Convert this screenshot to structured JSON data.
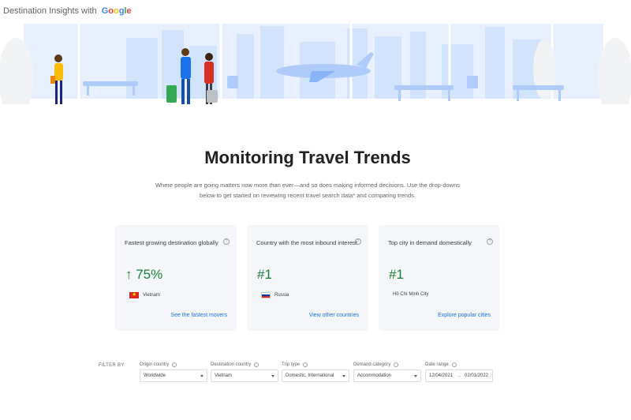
{
  "header": {
    "brand_text": "Destination Insights with",
    "brand_logo": "Google"
  },
  "hero": {
    "title": "Monitoring Travel Trends",
    "description": "Where people are going matters now more than ever—and so does making informed decisions. Use the drop-downs below to get started on reviewing recent travel search data* and comparing trends."
  },
  "cards": [
    {
      "title": "Fastest growing destination globally",
      "metric": "↑ 75%",
      "place": "Vietnam",
      "flag": "vn",
      "link": "See the fastest movers"
    },
    {
      "title": "Country with the most inbound interest",
      "metric": "#1",
      "place": "Russia",
      "flag": "ru",
      "link": "View other countries"
    },
    {
      "title": "Top city in demand domestically",
      "metric": "#1",
      "place": "Hồ Chí Minh City",
      "flag": "",
      "link": "Explore popular cities"
    }
  ],
  "filters": {
    "label": "FILTER BY:",
    "origin": {
      "label": "Origin country",
      "value": "Worldwide"
    },
    "destination": {
      "label": "Destination country",
      "value": "Vietnam"
    },
    "trip_type": {
      "label": "Trip type",
      "value": "Domestic, International"
    },
    "demand": {
      "label": "Demand category",
      "value": "Accommodation"
    },
    "date_range": {
      "label": "Date range",
      "start": "12/04/2021",
      "end": "02/01/2022"
    }
  },
  "colors": {
    "accent_green": "#188038",
    "link_blue": "#1a73e8",
    "hero_blue": "#aecbfa",
    "card_bg": "#f4f6f9"
  }
}
